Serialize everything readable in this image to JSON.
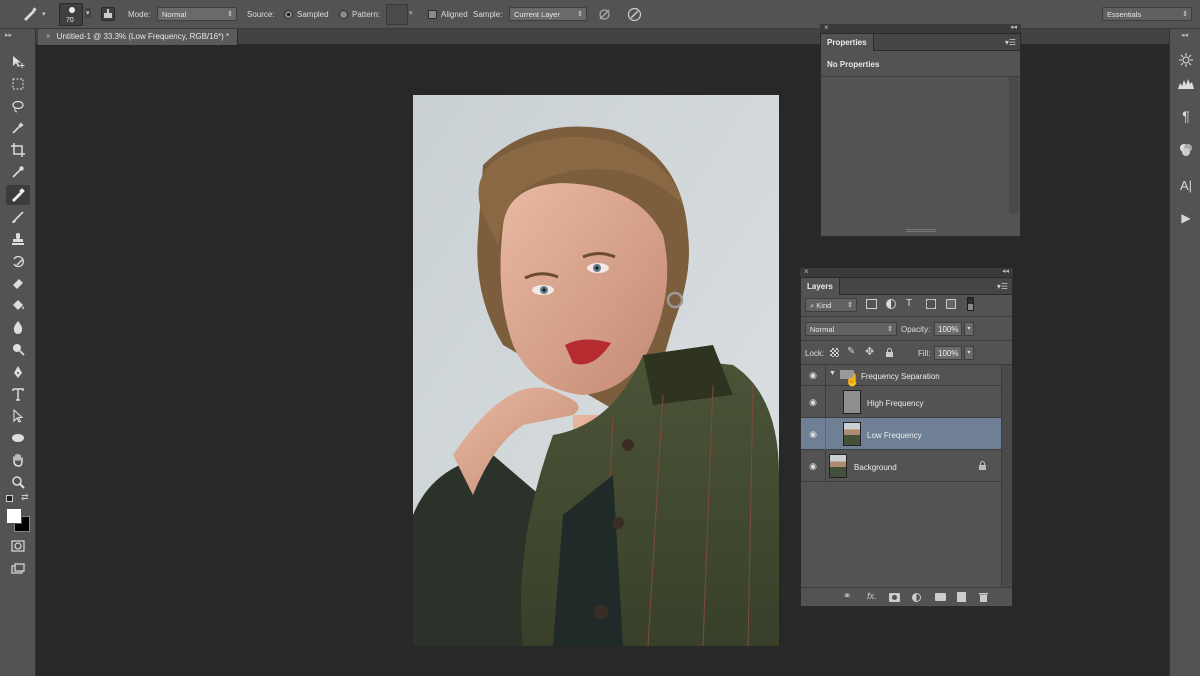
{
  "options_bar": {
    "brush_size": "70",
    "mode_label": "Mode:",
    "mode_value": "Normal",
    "source_label": "Source:",
    "source_sampled": "Sampled",
    "source_pattern": "Pattern:",
    "aligned_label": "Aligned",
    "sample_label": "Sample:",
    "sample_value": "Current Layer",
    "workspace": "Essentials"
  },
  "document_tab": {
    "title": "Untitled-1 @ 33.3% (Low Frequency, RGB/16*) *"
  },
  "properties_panel": {
    "tab": "Properties",
    "content": "No Properties"
  },
  "layers_panel": {
    "tab": "Layers",
    "filter_kind": "Kind",
    "blend_mode": "Normal",
    "opacity_label": "Opacity:",
    "opacity_value": "100%",
    "lock_label": "Lock:",
    "fill_label": "Fill:",
    "fill_value": "100%",
    "layers": [
      {
        "name": "Frequency Separation",
        "type": "group",
        "selected": false
      },
      {
        "name": "High Frequency",
        "type": "layer",
        "selected": false
      },
      {
        "name": "Low Frequency",
        "type": "layer",
        "selected": true
      },
      {
        "name": "Background",
        "type": "layer",
        "selected": false,
        "locked": true
      }
    ]
  },
  "colors": {
    "selected_layer": "#6e7f96",
    "panel_bg": "#535353",
    "canvas_bg": "#282828"
  }
}
